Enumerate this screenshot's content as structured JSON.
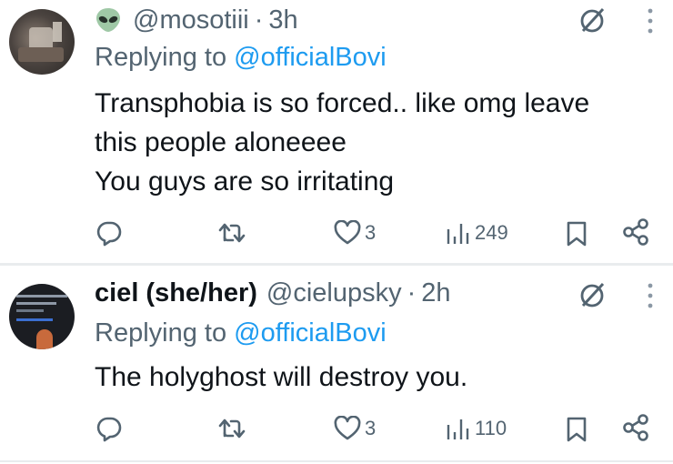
{
  "tweets": [
    {
      "handle": "@mosotiii",
      "separator": "·",
      "time": "3h",
      "replying_prefix": "Replying to ",
      "replying_to": "@officialBovi",
      "body_lines": [
        "Transphobia is so forced.. like omg leave",
        "this people aloneeee",
        "You guys are so irritating"
      ],
      "likes": "3",
      "views": "249"
    },
    {
      "display_name": "ciel (she/her)",
      "handle": "@cielupsky",
      "separator": "·",
      "time": "2h",
      "replying_prefix": "Replying to ",
      "replying_to": "@officialBovi",
      "body_lines": [
        "The holyghost will destroy you."
      ],
      "likes": "3",
      "views": "110"
    }
  ],
  "icons": [
    "alien-emoji-icon",
    "grok-icon",
    "more-icon",
    "reply-icon",
    "retweet-icon",
    "like-icon",
    "views-icon",
    "bookmark-icon",
    "share-icon"
  ],
  "colors": {
    "text": "#0f1419",
    "secondary": "#536471",
    "link": "#1d9bf0",
    "divider": "#e9ecee"
  }
}
